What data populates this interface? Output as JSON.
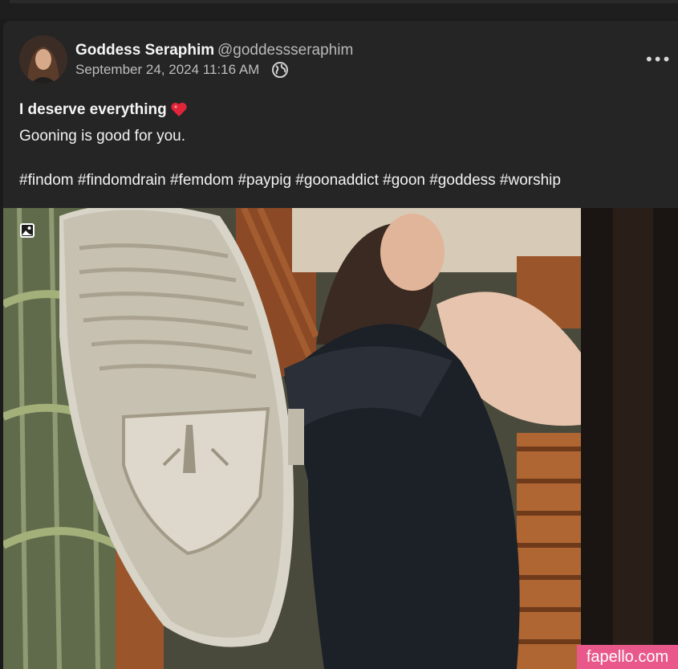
{
  "post": {
    "author_name": "Goddess Seraphim",
    "author_handle": "@goddessseraphim",
    "date": "September 24, 2024 11:16 AM",
    "title": "I deserve everything",
    "line2": "Gooning is good for you.",
    "tags": "#findom #findomdrain #femdom #paypig #goonaddict #goon #goddess #worship",
    "visibility_icon": "globe-icon",
    "menu_icon": "more-icon",
    "title_emoji": "heart-icon",
    "media_icon": "image-icon"
  },
  "watermark": {
    "text": "fapello.com",
    "color": "#e9588a"
  },
  "colors": {
    "background": "#1b1b1b",
    "card": "#252525",
    "text": "#f2f2f2",
    "muted": "#bdbdbd",
    "heart": "#e0253a"
  }
}
